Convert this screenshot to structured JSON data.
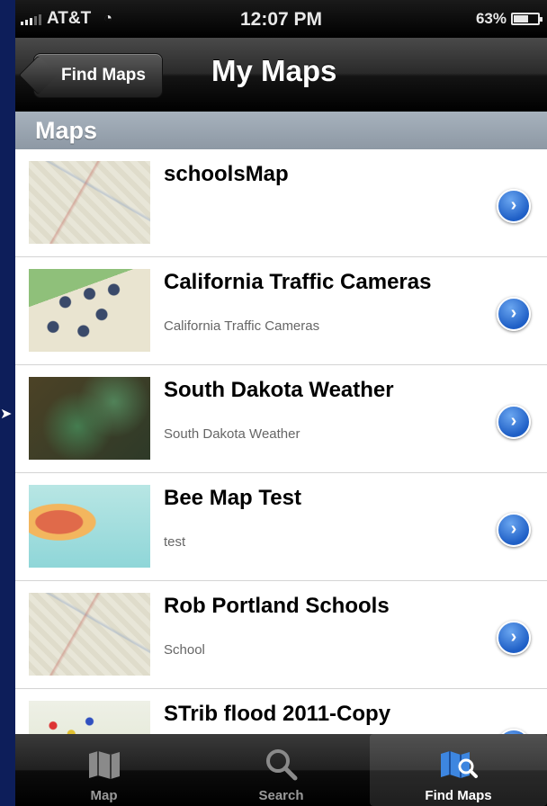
{
  "status_bar": {
    "carrier": "AT&T",
    "time": "12:07 PM",
    "battery_text": "63%",
    "battery_level": 0.63
  },
  "nav": {
    "back_label": "Find Maps",
    "title": "My Maps"
  },
  "section": {
    "header": "Maps"
  },
  "maps": [
    {
      "title": "schoolsMap",
      "subtitle": ""
    },
    {
      "title": "California Traffic Cameras",
      "subtitle": "California Traffic Cameras"
    },
    {
      "title": "South Dakota Weather",
      "subtitle": "South Dakota Weather"
    },
    {
      "title": "Bee Map Test",
      "subtitle": "test"
    },
    {
      "title": "Rob Portland Schools",
      "subtitle": "School"
    },
    {
      "title": "STrib flood 2011-Copy",
      "subtitle": ""
    }
  ],
  "tabs": [
    {
      "label": "Map",
      "icon": "map-icon",
      "active": false
    },
    {
      "label": "Search",
      "icon": "search-icon",
      "active": false
    },
    {
      "label": "Find Maps",
      "icon": "find-maps-icon",
      "active": true
    }
  ],
  "colors": {
    "background": "#0d1e5a",
    "disclosure": "#1f5fc6",
    "section": "#9aa5b1"
  }
}
